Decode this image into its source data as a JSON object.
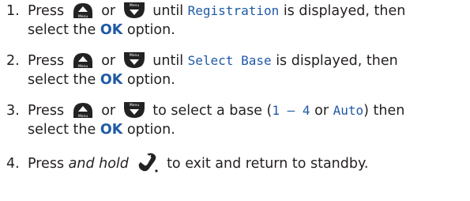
{
  "steps": [
    {
      "num": "1.",
      "press": "Press",
      "or": "or",
      "until": "until",
      "display": "Registration",
      "after": "is displayed, then",
      "line2a": "select the",
      "ok": "OK",
      "line2b": "option."
    },
    {
      "num": "2.",
      "press": "Press",
      "or": "or",
      "until": "until",
      "display": "Select Base",
      "after": "is displayed, then",
      "line2a": "select the",
      "ok": "OK",
      "line2b": "option."
    },
    {
      "num": "3.",
      "press": "Press",
      "or": "or",
      "mid": "to select a base (",
      "range": "1 – 4",
      "or2": "or",
      "auto": "Auto",
      "close": ") then",
      "line2a": "select the",
      "ok": "OK",
      "line2b": "option."
    },
    {
      "num": "4.",
      "press": "Press",
      "hold": "and hold",
      "after": "to exit and return to standby."
    }
  ],
  "icons": {
    "up_button": "up-arrow-button-icon",
    "down_button": "menu-down-button-icon",
    "end_call": "end-call-icon",
    "up_label": "Menu",
    "down_label": "Menu"
  },
  "colors": {
    "text": "#231f20",
    "accent": "#1f5aa6",
    "button": "#222222"
  }
}
